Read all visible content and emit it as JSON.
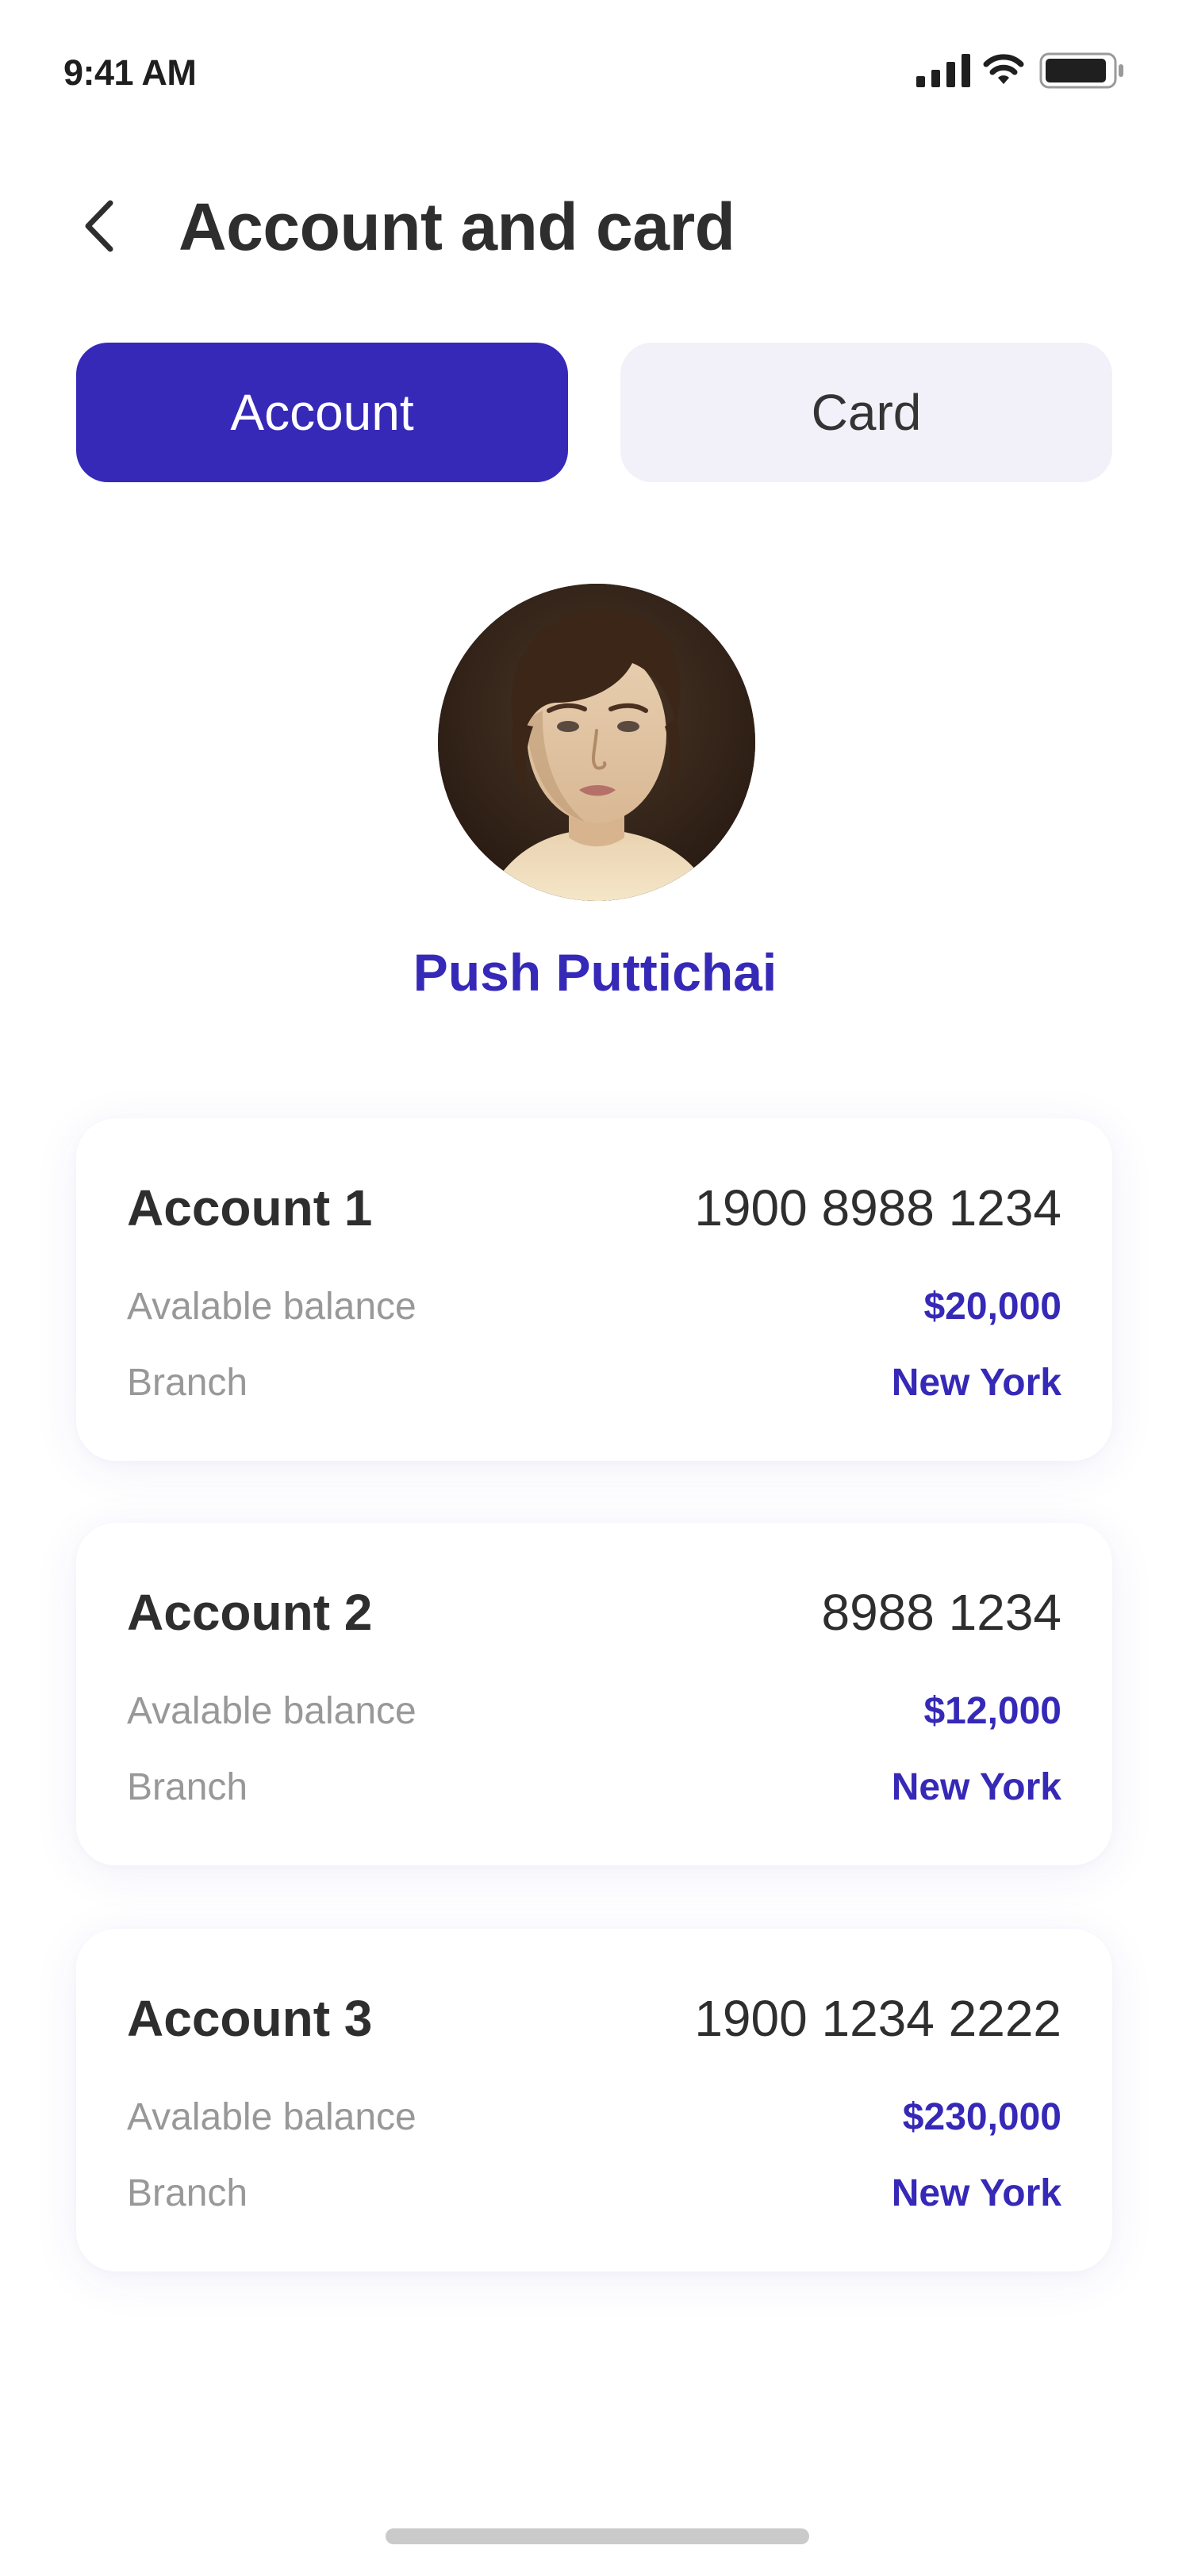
{
  "status_bar": {
    "time": "9:41 AM",
    "icons": [
      "cellular-signal-icon",
      "wifi-icon",
      "battery-icon"
    ]
  },
  "header": {
    "title": "Account and card",
    "back_icon": "chevron-left-icon"
  },
  "tabs": [
    {
      "label": "Account",
      "active": true
    },
    {
      "label": "Card",
      "active": false
    }
  ],
  "profile": {
    "name": "Push Puttichai"
  },
  "accounts": [
    {
      "name": "Account 1",
      "number": "1900 8988 1234",
      "balance_label": "Avalable balance",
      "balance": "$20,000",
      "branch_label": "Branch",
      "branch": "New York"
    },
    {
      "name": "Account 2",
      "number": "8988 1234",
      "balance_label": "Avalable balance",
      "balance": "$12,000",
      "branch_label": "Branch",
      "branch": "New York"
    },
    {
      "name": "Account 3",
      "number": "1900 1234 2222",
      "balance_label": "Avalable balance",
      "balance": "$230,000",
      "branch_label": "Branch",
      "branch": "New York"
    }
  ],
  "colors": {
    "primary": "#3629b7",
    "tab_inactive_bg": "#f2f1f9",
    "text_dark": "#343434",
    "text_muted": "#989898"
  }
}
